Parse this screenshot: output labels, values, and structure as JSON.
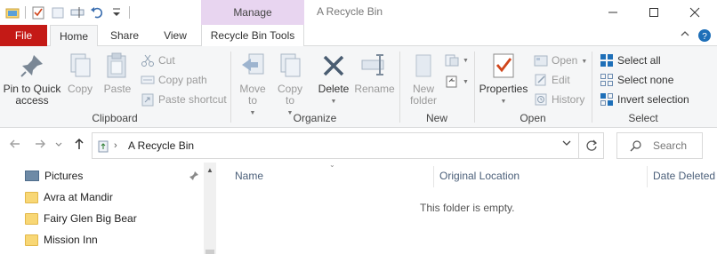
{
  "window": {
    "title": "A Recycle Bin",
    "contextual_group": "Manage",
    "controls": [
      "minimize",
      "maximize",
      "close"
    ]
  },
  "tabs": {
    "file": "File",
    "home": "Home",
    "share": "Share",
    "view": "View",
    "recycle_bin_tools": "Recycle Bin Tools"
  },
  "ribbon": {
    "clipboard": {
      "label": "Clipboard",
      "pin": "Pin to Quick access",
      "copy": "Copy",
      "paste": "Paste",
      "cut": "Cut",
      "copy_path": "Copy path",
      "paste_shortcut": "Paste shortcut"
    },
    "organize": {
      "label": "Organize",
      "move_to": "Move to",
      "copy_to": "Copy to",
      "delete": "Delete",
      "rename": "Rename"
    },
    "new": {
      "label": "New",
      "new_folder": "New folder"
    },
    "open": {
      "label": "Open",
      "properties": "Properties",
      "open": "Open",
      "edit": "Edit",
      "history": "History"
    },
    "select": {
      "label": "Select",
      "select_all": "Select all",
      "select_none": "Select none",
      "invert": "Invert selection"
    }
  },
  "address": {
    "path": "A Recycle Bin",
    "search_placeholder": "Search A..."
  },
  "navpane": {
    "items": [
      {
        "label": "Pictures",
        "icon": "pictures-icon",
        "pinned": true
      },
      {
        "label": "Avra at Mandir",
        "icon": "folder-icon"
      },
      {
        "label": "Fairy Glen Big Bear",
        "icon": "folder-icon"
      },
      {
        "label": "Mission Inn",
        "icon": "folder-icon"
      }
    ]
  },
  "content": {
    "columns": [
      "Name",
      "Original Location",
      "Date Deleted"
    ],
    "empty_message": "This folder is empty."
  },
  "colors": {
    "file_tab": "#c41a16",
    "manage_tab": "#e8d5f0",
    "ribbon_bg": "#f5f6f7",
    "accent_blue": "#1e6fb8"
  }
}
